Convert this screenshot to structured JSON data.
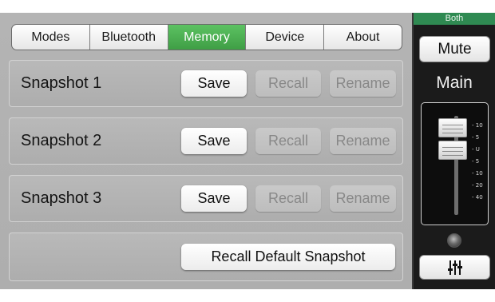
{
  "tabs": [
    {
      "label": "Modes",
      "active": false
    },
    {
      "label": "Bluetooth",
      "active": false
    },
    {
      "label": "Memory",
      "active": true
    },
    {
      "label": "Device",
      "active": false
    },
    {
      "label": "About",
      "active": false
    }
  ],
  "snapshots": [
    {
      "label": "Snapshot 1",
      "save": "Save",
      "recall": "Recall",
      "rename": "Rename"
    },
    {
      "label": "Snapshot 2",
      "save": "Save",
      "recall": "Recall",
      "rename": "Rename"
    },
    {
      "label": "Snapshot 3",
      "save": "Save",
      "recall": "Recall",
      "rename": "Rename"
    }
  ],
  "recall_default_label": "Recall Default Snapshot",
  "side_panel": {
    "tag": "Both",
    "mute_label": "Mute",
    "channel_label": "Main",
    "scale": [
      "10",
      "5",
      "U",
      "5",
      "10",
      "20",
      "40"
    ],
    "eq_icon": "eq-sliders-icon"
  },
  "colors": {
    "accent": "#4cb052",
    "tag": "#2f8a52",
    "panel": "#1b1b1b"
  }
}
